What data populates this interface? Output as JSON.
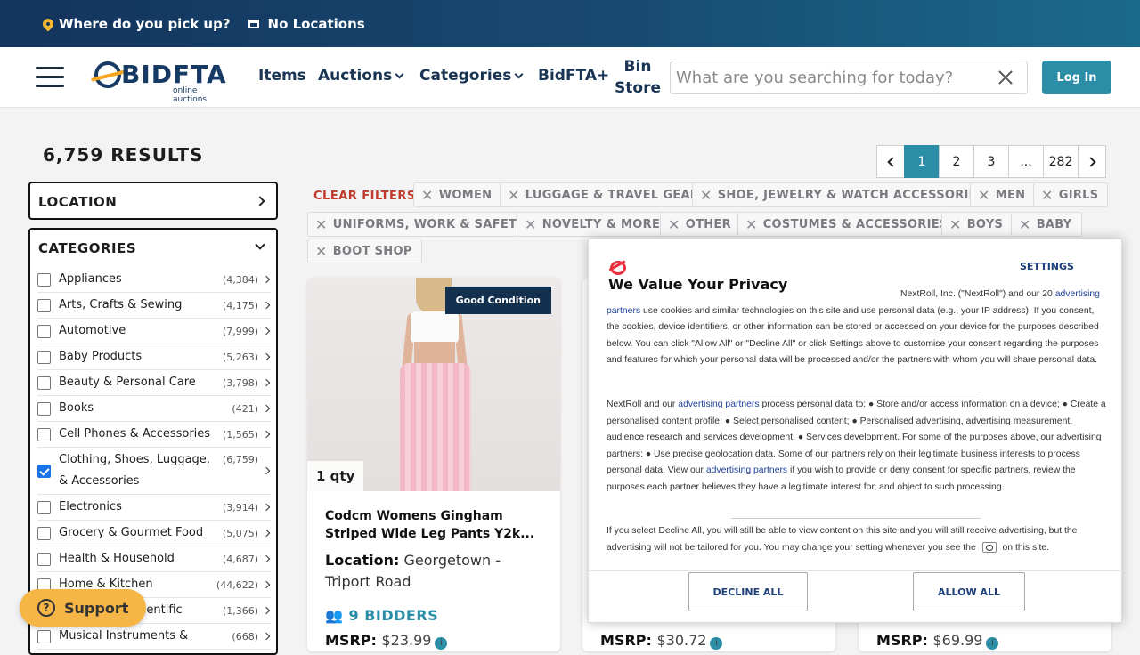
{
  "topbar": {
    "pickup": "Where do you pick up?",
    "locations": "No Locations"
  },
  "nav": {
    "logo_word": "BIDFTA",
    "logo_sub": "online auctions",
    "items": "Items",
    "auctions": "Auctions",
    "categories": "Categories",
    "bidftaplus": "BidFTA+",
    "bin": "Bin",
    "store": "Store",
    "search_placeholder": "What are you searching for today?",
    "login": "Log In"
  },
  "results": "6,759 RESULTS",
  "pager": {
    "pages": [
      "1",
      "2",
      "3",
      "...",
      "282"
    ]
  },
  "location_panel": {
    "title": "LOCATION"
  },
  "categories_panel": {
    "title": "CATEGORIES",
    "items": [
      {
        "name": "Appliances",
        "count": "(4,384)",
        "checked": false
      },
      {
        "name": "Arts, Crafts & Sewing",
        "count": "(4,175)",
        "checked": false
      },
      {
        "name": "Automotive",
        "count": "(7,999)",
        "checked": false
      },
      {
        "name": "Baby Products",
        "count": "(5,263)",
        "checked": false
      },
      {
        "name": "Beauty & Personal Care",
        "count": "(3,798)",
        "checked": false
      },
      {
        "name": "Books",
        "count": "(421)",
        "checked": false
      },
      {
        "name": "Cell Phones & Accessories",
        "count": "(1,565)",
        "checked": false
      },
      {
        "name": "Clothing, Shoes, Luggage, & Accessories",
        "count": "(6,759)",
        "checked": true
      },
      {
        "name": "Electronics",
        "count": "(3,914)",
        "checked": false
      },
      {
        "name": "Grocery & Gourmet Food",
        "count": "(5,075)",
        "checked": false
      },
      {
        "name": "Health & Household",
        "count": "(4,687)",
        "checked": false
      },
      {
        "name": "Home & Kitchen",
        "count": "(44,622)",
        "checked": false
      },
      {
        "name": "Industrial & Scientific",
        "count": "(1,366)",
        "checked": false
      },
      {
        "name": "Musical Instruments &",
        "count": "(668)",
        "checked": false
      }
    ]
  },
  "filters": {
    "clear": "CLEAR FILTERS",
    "chips": [
      "WOMEN",
      "LUGGAGE & TRAVEL GEAR",
      "SHOE, JEWELRY & WATCH ACCESSORIES",
      "MEN",
      "GIRLS",
      "UNIFORMS, WORK & SAFETY",
      "NOVELTY & MORE",
      "OTHER",
      "COSTUMES & ACCESSORIES",
      "BOYS",
      "BABY",
      "BOOT SHOP"
    ]
  },
  "cards": [
    {
      "badge": "Good Condition",
      "qty": "1 qty",
      "title": "Codcm Womens Gingham Striped Wide Leg Pants Y2k...",
      "loc_label": "Location:",
      "loc_value": "Georgetown - Triport Road",
      "bidders": "9 BIDDERS",
      "msrp_label": "MSRP:",
      "msrp_value": "$23.99"
    },
    {
      "msrp_label": "MSRP:",
      "msrp_value": "$30.72"
    },
    {
      "msrp_label": "MSRP:",
      "msrp_value": "$69.99"
    }
  ],
  "privacy": {
    "settings": "SETTINGS",
    "title": "We Value Your Privacy",
    "p1_a": "NextRoll, Inc. (\"NextRoll\") and our 20",
    "p1_link": "advertising partners",
    "p1_b": "use cookies and similar technologies on this site and use personal data (e.g., your IP address). If you consent, the cookies, device identifiers, or other information can be stored or accessed on your device for the purposes described below. You can click \"Allow All\" or \"Decline All\" or click Settings above to customise your consent regarding the purposes and features for which your personal data will be processed and/or the partners with whom you will share personal data.",
    "p2_a": "NextRoll and our",
    "p2_link": "advertising partners",
    "p2_b": "process personal data to: ● Store and/or access information on a device; ● Create a personalised content profile; ● Select personalised content; ● Personalised advertising, advertising measurement, audience research and services development; ● Services development. For some of the purposes above, our advertising partners: ● Use precise geolocation data. Some of our partners rely on their legitimate business interests to process personal data. View our",
    "p2_link2": "advertising partners",
    "p2_c": "if you wish to provide or deny consent for specific partners, review the purposes each partner believes they have a legitimate interest for, and object to such processing.",
    "p3_a": "If you select Decline All, you will still be able to view content on this site and you will still receive advertising, but the advertising will not be tailored for you. You may change your setting whenever you see the",
    "p3_b": "on this site.",
    "decline": "DECLINE ALL",
    "allow": "ALLOW ALL"
  },
  "support": "Support",
  "colors": {
    "accent": "#2b8ea6",
    "navy": "#14304f",
    "clear_red": "#c0392b",
    "support_yellow": "#f5b646"
  }
}
